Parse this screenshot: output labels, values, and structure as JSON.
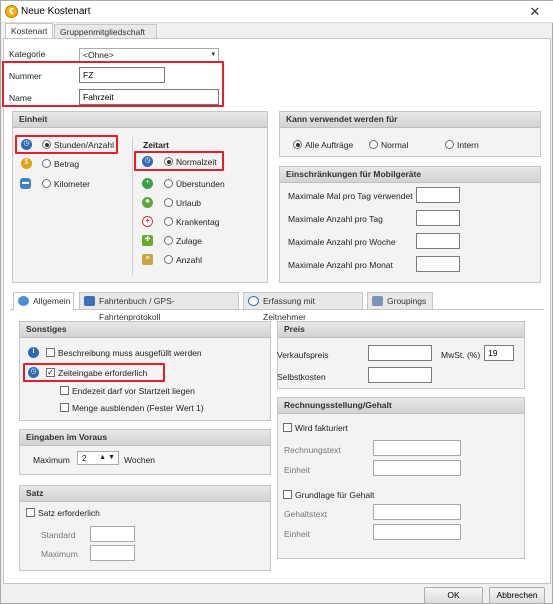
{
  "window": {
    "title": "Neue Kostenart",
    "app_icon": "coin-icon"
  },
  "top_tabs": [
    {
      "label": "Kostenart",
      "active": true
    },
    {
      "label": "Gruppenmitgliedschaft",
      "active": false
    }
  ],
  "general": {
    "kategorie_label": "Kategorie",
    "kategorie_value": "<Ohne>",
    "nummer_label": "Nummer",
    "nummer_value": "FZ",
    "name_label": "Name",
    "name_value": "Fahrzeit"
  },
  "einheit": {
    "title": "Einheit",
    "options": [
      {
        "label": "Stunden/Anzahl",
        "selected": true,
        "icon": "clock-icon"
      },
      {
        "label": "Betrag",
        "selected": false,
        "icon": "coin-icon"
      },
      {
        "label": "Kilometer",
        "selected": false,
        "icon": "car-icon"
      }
    ]
  },
  "zeitart": {
    "title": "Zeitart",
    "options": [
      {
        "label": "Normalzeit",
        "selected": true,
        "icon": "clock-icon"
      },
      {
        "label": "Überstunden",
        "selected": false,
        "icon": "clock-plus-icon"
      },
      {
        "label": "Urlaub",
        "selected": false,
        "icon": "palm-tree-icon"
      },
      {
        "label": "Krankentag",
        "selected": false,
        "icon": "medical-cross-icon"
      },
      {
        "label": "Zulage",
        "selected": false,
        "icon": "puzzle-icon"
      },
      {
        "label": "Anzahl",
        "selected": false,
        "icon": "abacus-icon"
      }
    ]
  },
  "verwendung": {
    "title": "Kann verwendet werden für",
    "options": [
      {
        "label": "Alle Aufträge",
        "selected": true
      },
      {
        "label": "Normal",
        "selected": false
      },
      {
        "label": "Intern",
        "selected": false
      }
    ]
  },
  "mobil": {
    "title": "Einschränkungen für Mobilgeräte",
    "rows": [
      {
        "label": "Maximale Mal pro Tag verwendet",
        "value": ""
      },
      {
        "label": "Maximale Anzahl pro Tag",
        "value": ""
      },
      {
        "label": "Maximale Anzahl pro Woche",
        "value": ""
      },
      {
        "label": "Maximale Anzahl pro Monat",
        "value": ""
      }
    ]
  },
  "sub_tabs": [
    {
      "label": "Allgemein",
      "active": true,
      "icon": "gear-icon"
    },
    {
      "label": "Fahrtenbuch / GPS-Fahrtenprotokoll",
      "active": false,
      "icon": "logbook-icon"
    },
    {
      "label": "Erfassung mit Zeitnehmer",
      "active": false,
      "icon": "stopwatch-icon"
    },
    {
      "label": "Groupings",
      "active": false,
      "icon": "groupings-icon"
    }
  ],
  "sonstiges": {
    "title": "Sonstiges",
    "items": [
      {
        "label": "Beschreibung muss ausgefüllt werden",
        "checked": false,
        "icon": "info-icon"
      },
      {
        "label": "Zeiteingabe erforderlich",
        "checked": true,
        "icon": "clock-icon"
      },
      {
        "label": "Endezeit darf vor Startzeit liegen",
        "checked": false
      },
      {
        "label": "Menge ausblenden (Fester Wert 1)",
        "checked": false
      }
    ]
  },
  "voraus": {
    "title": "Eingaben im Voraus",
    "maximum_label": "Maximum",
    "maximum_value": "2",
    "unit_label": "Wochen"
  },
  "satz": {
    "title": "Satz",
    "checkbox_label": "Satz erforderlich",
    "checked": false,
    "standard_label": "Standard",
    "maximum_label": "Maximum"
  },
  "preis": {
    "title": "Preis",
    "verkaufspreis_label": "Verkaufspreis",
    "mwst_label": "MwSt. (%)",
    "mwst_value": "19",
    "selbstkosten_label": "Selbstkosten"
  },
  "rechnung": {
    "title": "Rechnungsstellung/Gehalt",
    "wird_fakturiert_label": "Wird fakturiert",
    "rechnungstext_label": "Rechnungstext",
    "einheit_label": "Einheit",
    "grundlage_label": "Grundlage für Gehalt",
    "gehaltstext_label": "Gehaltstext",
    "einheit2_label": "Einheit"
  },
  "buttons": {
    "ok": "OK",
    "cancel": "Abbrechen"
  },
  "colors": {
    "highlight": "#e3202a",
    "panel_header": "#d8d8d8"
  }
}
